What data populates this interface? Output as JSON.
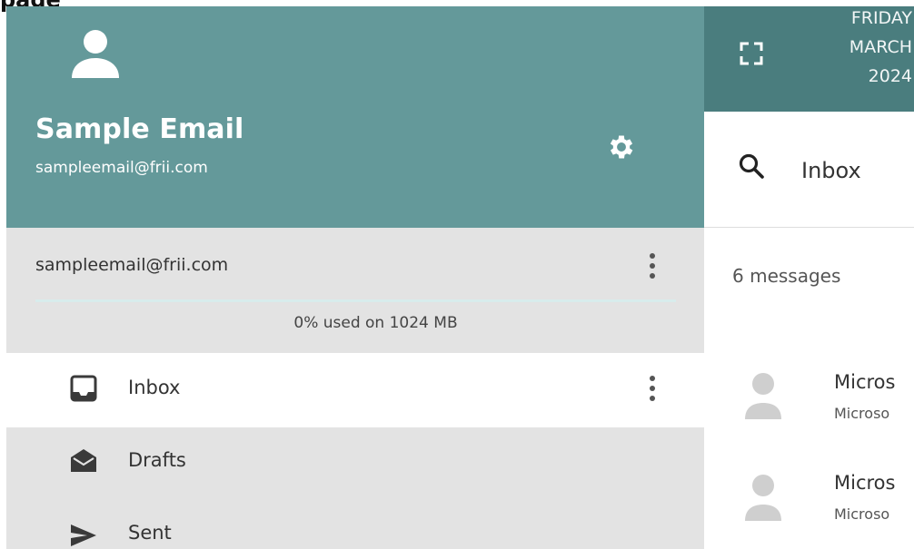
{
  "header": {
    "cut_text": "page"
  },
  "profile": {
    "name": "Sample Email",
    "email": "sampleemail@frii.com",
    "avatar_icon": "person-icon",
    "settings_icon": "gear-icon"
  },
  "account": {
    "email": "sampleemail@frii.com",
    "menu_icon": "more-vertical-icon",
    "storage_text": "0% used on 1024 MB",
    "storage_used_percent": 0
  },
  "nav": {
    "items": [
      {
        "label": "Inbox",
        "icon": "inbox-icon",
        "active": true
      },
      {
        "label": "Drafts",
        "icon": "drafts-icon",
        "active": false
      },
      {
        "label": "Sent",
        "icon": "send-icon",
        "active": false
      }
    ]
  },
  "topbar": {
    "date_line1": "FRIDAY",
    "date_line2": "MARCH",
    "date_line3": "2024",
    "fullscreen_icon": "fullscreen-icon"
  },
  "search": {
    "value": "Inbox",
    "icon": "search-icon"
  },
  "messages": {
    "count_text": "6 messages",
    "items": [
      {
        "sender": "Micros",
        "preview": "Microso"
      },
      {
        "sender": "Micros",
        "preview": "Microso"
      }
    ]
  },
  "colors": {
    "profile_bg": "#64999a",
    "topbar_bg": "#4a7d7e",
    "sidebar_bg": "#e3e3e3"
  }
}
